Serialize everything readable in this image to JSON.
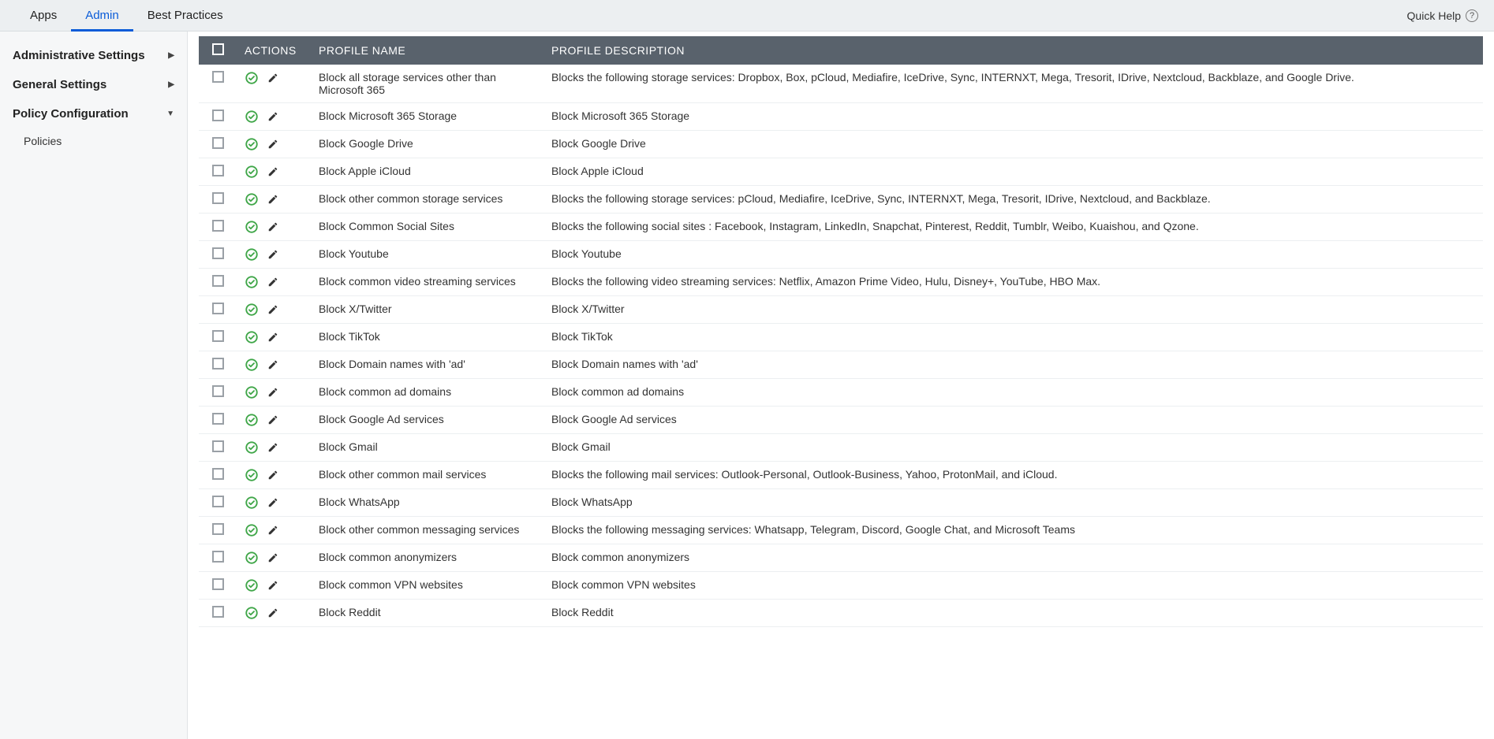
{
  "topbar": {
    "tabs": [
      {
        "label": "Apps",
        "active": false
      },
      {
        "label": "Admin",
        "active": true
      },
      {
        "label": "Best Practices",
        "active": false
      }
    ],
    "quick_help": "Quick Help"
  },
  "sidebar": {
    "items": [
      {
        "label": "Administrative Settings",
        "caret": "right",
        "expanded": false
      },
      {
        "label": "General Settings",
        "caret": "right",
        "expanded": false
      },
      {
        "label": "Policy Configuration",
        "caret": "down",
        "expanded": true,
        "children": [
          {
            "label": "Policies"
          }
        ]
      }
    ]
  },
  "table": {
    "headers": {
      "actions": "ACTIONS",
      "name": "PROFILE NAME",
      "description": "PROFILE DESCRIPTION"
    },
    "rows": [
      {
        "name": "Block all storage services other than Microsoft 365",
        "description": "Blocks the following storage services: Dropbox, Box, pCloud, Mediafire, IceDrive, Sync, INTERNXT, Mega, Tresorit, IDrive, Nextcloud, Backblaze, and Google Drive."
      },
      {
        "name": "Block Microsoft 365 Storage",
        "description": "Block Microsoft 365 Storage"
      },
      {
        "name": "Block Google Drive",
        "description": "Block Google Drive"
      },
      {
        "name": "Block Apple iCloud",
        "description": "Block Apple iCloud"
      },
      {
        "name": "Block other common storage services",
        "description": "Blocks the following storage services: pCloud, Mediafire, IceDrive, Sync, INTERNXT, Mega, Tresorit, IDrive, Nextcloud, and Backblaze."
      },
      {
        "name": "Block Common Social Sites",
        "description": "Blocks the following social sites : Facebook, Instagram, LinkedIn, Snapchat, Pinterest, Reddit, Tumblr, Weibo, Kuaishou, and Qzone."
      },
      {
        "name": "Block Youtube",
        "description": "Block Youtube"
      },
      {
        "name": "Block common video streaming services",
        "description": "Blocks the following video streaming services: Netflix, Amazon Prime Video, Hulu, Disney+, YouTube, HBO Max."
      },
      {
        "name": "Block X/Twitter",
        "description": "Block X/Twitter"
      },
      {
        "name": "Block TikTok",
        "description": "Block TikTok"
      },
      {
        "name": "Block Domain names with 'ad'",
        "description": "Block Domain names with 'ad'"
      },
      {
        "name": "Block common ad domains",
        "description": "Block common ad domains"
      },
      {
        "name": "Block Google Ad services",
        "description": "Block Google Ad services"
      },
      {
        "name": "Block Gmail",
        "description": "Block Gmail"
      },
      {
        "name": "Block other common mail services",
        "description": "Blocks the following mail services: Outlook-Personal, Outlook-Business, Yahoo, ProtonMail, and iCloud."
      },
      {
        "name": "Block WhatsApp",
        "description": "Block WhatsApp"
      },
      {
        "name": "Block other common messaging services",
        "description": "Blocks the following messaging services: Whatsapp, Telegram, Discord, Google Chat, and Microsoft Teams"
      },
      {
        "name": "Block common anonymizers",
        "description": "Block common anonymizers"
      },
      {
        "name": "Block common VPN websites",
        "description": "Block common VPN websites"
      },
      {
        "name": "Block Reddit",
        "description": "Block Reddit"
      }
    ]
  }
}
